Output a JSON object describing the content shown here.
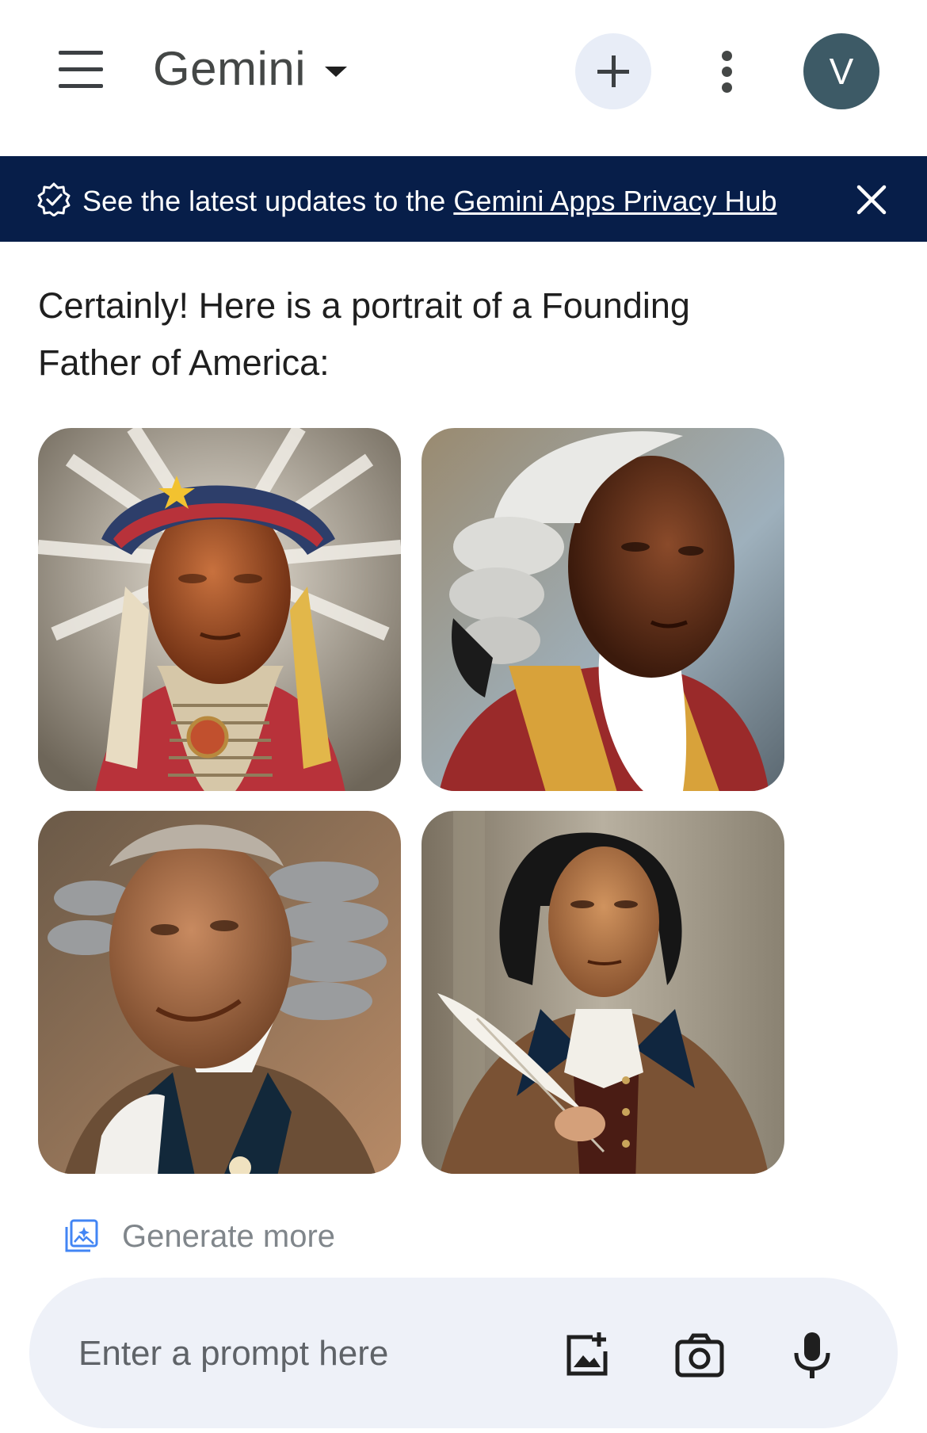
{
  "header": {
    "title": "Gemini",
    "avatar_initial": "V",
    "icons": [
      "menu-icon",
      "dropdown-caret-icon",
      "plus-icon",
      "more-vert-icon"
    ]
  },
  "banner": {
    "text_prefix": "See the latest updates to the ",
    "link_text": "Gemini Apps Privacy Hub",
    "icons": [
      "verified-badge-icon",
      "close-icon"
    ],
    "background": "#071e49"
  },
  "message": {
    "text": "Certainly! Here is a portrait of a Founding Father of America:"
  },
  "images": [
    {
      "icon": "portrait-image-1"
    },
    {
      "icon": "portrait-image-2"
    },
    {
      "icon": "portrait-image-3"
    },
    {
      "icon": "portrait-image-4"
    }
  ],
  "generate_more": {
    "label": "Generate more",
    "icon": "generate-images-icon"
  },
  "prompt": {
    "placeholder": "Enter a prompt here",
    "icons": [
      "add-image-icon",
      "camera-icon",
      "microphone-icon"
    ]
  },
  "colors": {
    "accent": "#4285f4",
    "avatar": "#3d5a66",
    "prompt_bg": "#eef1f8",
    "new_chat_bg": "#e8edf7"
  }
}
